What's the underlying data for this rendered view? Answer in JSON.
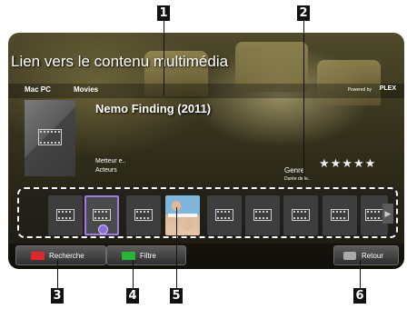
{
  "callouts": [
    "1",
    "2",
    "3",
    "4",
    "5",
    "6"
  ],
  "header": {
    "title": "Lien vers le contenu multimédia",
    "breadcrumb": [
      "Mac PC",
      "Movies"
    ],
    "powered_by": "Powered by",
    "brand": "PLEX"
  },
  "movie": {
    "title": "Nemo Finding (2011)",
    "director_label": "Metteur e..",
    "actors_label": "Acteurs",
    "genre_label": "Genre",
    "duration_label": "Durée de le..",
    "rating_stars": "★★★★★",
    "rating": 5
  },
  "strip": {
    "selected_index": 1,
    "poster_index": 2,
    "next_arrow": "▶"
  },
  "buttons": {
    "search_label": "Recherche",
    "filter_label": "Filtre",
    "back_label": "Retour"
  },
  "colors": {
    "red": "#e0262b",
    "green": "#27b535",
    "selection": "#9b7ce8"
  },
  "icons": [
    "film-icon",
    "back-icon",
    "next-arrow-icon"
  ]
}
